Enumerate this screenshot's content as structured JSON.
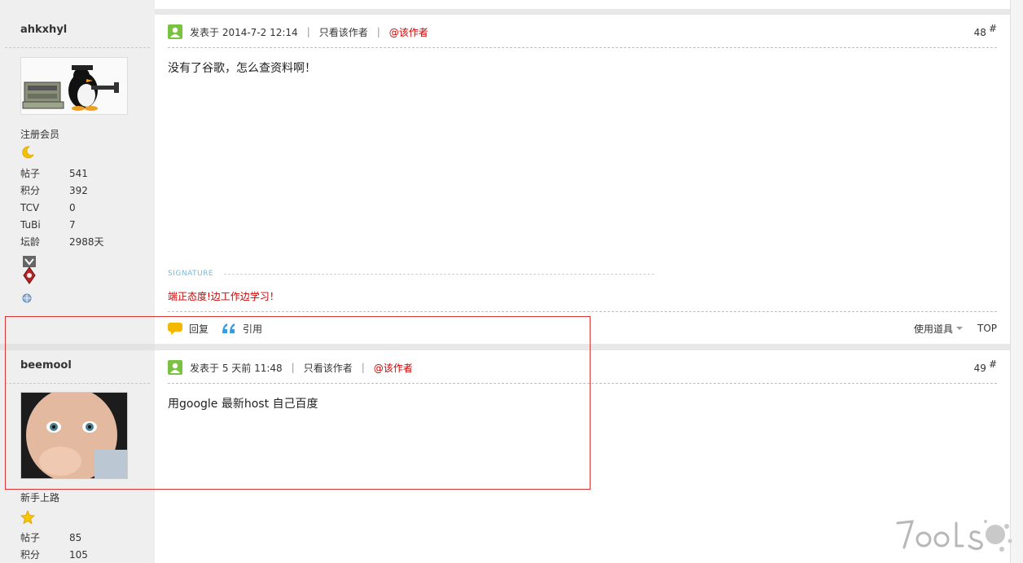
{
  "posts": [
    {
      "author": "ahkxhyl",
      "group": "注册会员",
      "stats": [
        {
          "label": "帖子",
          "value": "541"
        },
        {
          "label": "积分",
          "value": "392"
        },
        {
          "label": "TCV",
          "value": "0"
        },
        {
          "label": "TuBi",
          "value": "7"
        },
        {
          "label": "坛龄",
          "value": "2988天"
        }
      ],
      "posted_at": "发表于 2014-7-2 12:14",
      "author_only": "只看该作者",
      "at_author": "@该作者",
      "floor": "48",
      "floor_mark": "#",
      "content": "没有了谷歌，怎么查资料啊！",
      "signature_label": "SIGNATURE",
      "signature": "端正态度!边工作边学习！"
    },
    {
      "author": "beemool",
      "group": "新手上路",
      "stats": [
        {
          "label": "帖子",
          "value": "85"
        },
        {
          "label": "积分",
          "value": "105"
        }
      ],
      "posted_at": "发表于 5 天前 11:48",
      "author_only": "只看该作者",
      "at_author": "@该作者",
      "floor": "49",
      "floor_mark": "#",
      "content": "用google 最新host 自己百度"
    }
  ],
  "footer": {
    "reply": "回复",
    "quote": "引用",
    "tools": "使用道具",
    "top": "TOP"
  },
  "icons": {
    "online": "online-status-icon",
    "rank1": "moon-rank-icon",
    "rank2": "star-rank-icon",
    "reply": "reply-bubble-icon",
    "quote": "quote-icon"
  },
  "colors": {
    "accent_red": "#cc0000",
    "sig_blue": "#7ab8d8",
    "highlight": "#dd3333"
  }
}
